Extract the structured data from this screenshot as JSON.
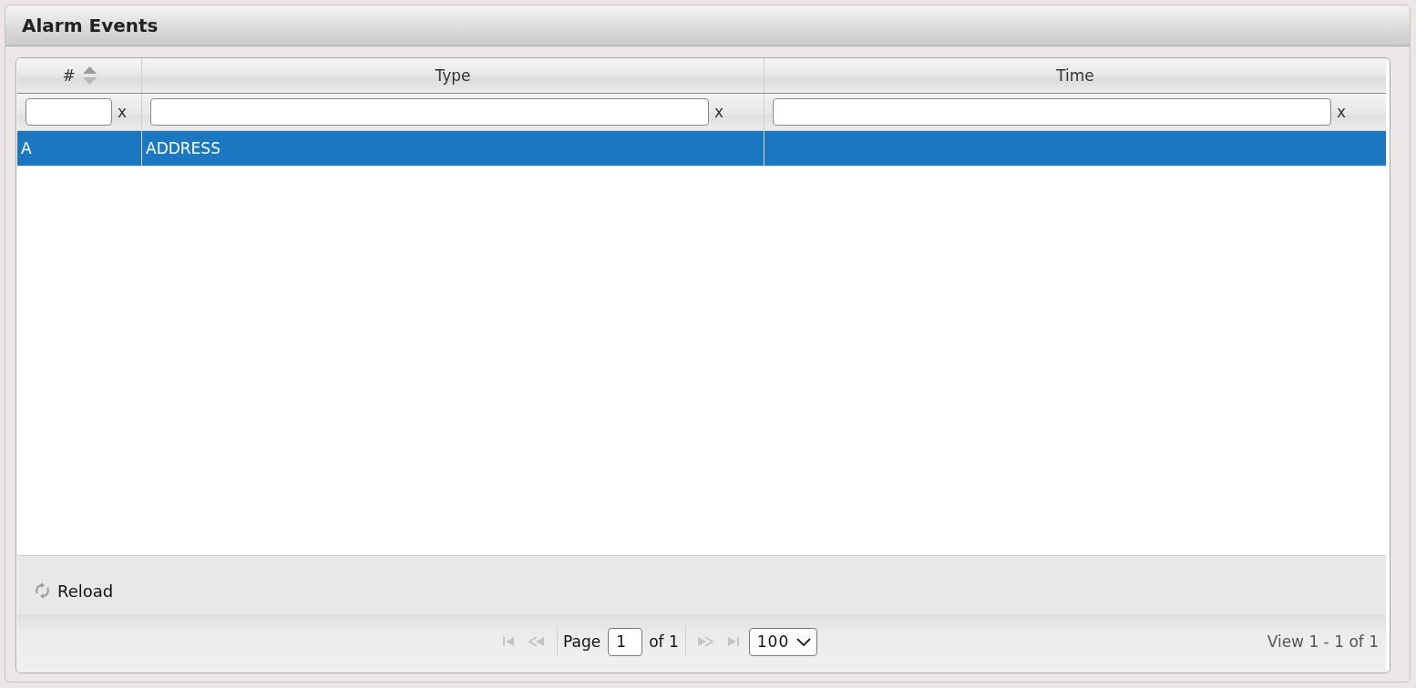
{
  "window": {
    "title": "Alarm Events"
  },
  "table": {
    "columns": [
      {
        "label": "#",
        "sortable": true
      },
      {
        "label": "Type",
        "sortable": false
      },
      {
        "label": "Time",
        "sortable": false
      }
    ],
    "filters": [
      {
        "clear_label": "x"
      },
      {
        "clear_label": "x"
      },
      {
        "clear_label": "x"
      }
    ],
    "rows": [
      {
        "selected": true,
        "cells": [
          "A",
          "ADDRESS"
        ]
      }
    ]
  },
  "toolbar": {
    "reload_label": "Reload"
  },
  "pager": {
    "nav_before": [
      {
        "kind": "first",
        "disabled": true
      },
      {
        "kind": "prev",
        "disabled": true
      }
    ],
    "page_label": "Page",
    "page": "1",
    "page_count_label": "of 1",
    "nav_after": [
      {
        "kind": "next",
        "disabled": true
      },
      {
        "kind": "last",
        "disabled": true
      }
    ],
    "page_size": "100",
    "view_info": "View 1 - 1 of 1"
  }
}
